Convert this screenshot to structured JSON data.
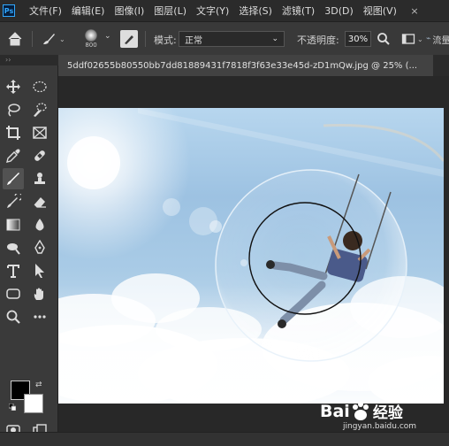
{
  "menubar": {
    "items": [
      "文件(F)",
      "编辑(E)",
      "图像(I)",
      "图层(L)",
      "文字(Y)",
      "选择(S)",
      "滤镜(T)",
      "3D(D)",
      "视图(V)"
    ]
  },
  "options": {
    "brush_size": "800",
    "mode_label": "模式:",
    "mode_value": "正常",
    "opacity_label": "不透明度:",
    "opacity_value": "30%",
    "flow_label": "流量"
  },
  "document": {
    "tab_title": "5ddf02655b80550bb7dd81889431f7818f3f63e33e45d-zD1mQw.jpg @ 25% (...",
    "close_symbol": "×"
  },
  "watermark": {
    "brand": "Bai",
    "brand_suffix": "经验",
    "url": "jingyan.baidu.com"
  },
  "colors": {
    "foreground": "#000000",
    "background": "#ffffff",
    "accent": "#31a8ff"
  }
}
